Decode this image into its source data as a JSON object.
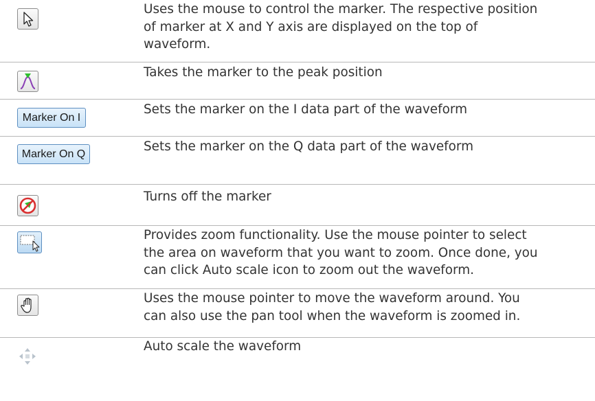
{
  "rows": [
    {
      "icon": "cursor-arrow-icon",
      "description": [
        "Uses the mouse to control the marker. The respective position",
        "of marker at X and Y axis are displayed on the top of",
        "waveform."
      ]
    },
    {
      "icon": "marker-peak-icon",
      "description": [
        "Takes the marker to the peak position"
      ]
    },
    {
      "icon": "marker-on-i-button",
      "button_label": "Marker On I",
      "description": [
        "Sets the marker on the I data part of the waveform"
      ]
    },
    {
      "icon": "marker-on-q-button",
      "button_label": "Marker On Q",
      "description": [
        "Sets the marker on the Q data part of the waveform"
      ]
    },
    {
      "icon": "marker-off-icon",
      "description": [
        "Turns off the marker"
      ]
    },
    {
      "icon": "zoom-select-icon",
      "description": [
        "Provides zoom functionality. Use the mouse pointer to select",
        "the area on waveform that you want to zoom. Once done, you",
        "can click Auto scale icon to zoom out the waveform."
      ]
    },
    {
      "icon": "pan-hand-icon",
      "description": [
        "Uses the mouse pointer to move the waveform around. You",
        "can also use the pan tool when the waveform is zoomed in."
      ]
    },
    {
      "icon": "auto-scale-icon",
      "description": [
        "Auto scale the waveform"
      ]
    }
  ],
  "colors": {
    "text": "#333333",
    "divider": "#b7b7b7",
    "peak_curve": "#8a3fb5",
    "peak_marker": "#2fbf2f",
    "off_circle": "#d93030",
    "text_button_fill": "#c8e2f7"
  }
}
